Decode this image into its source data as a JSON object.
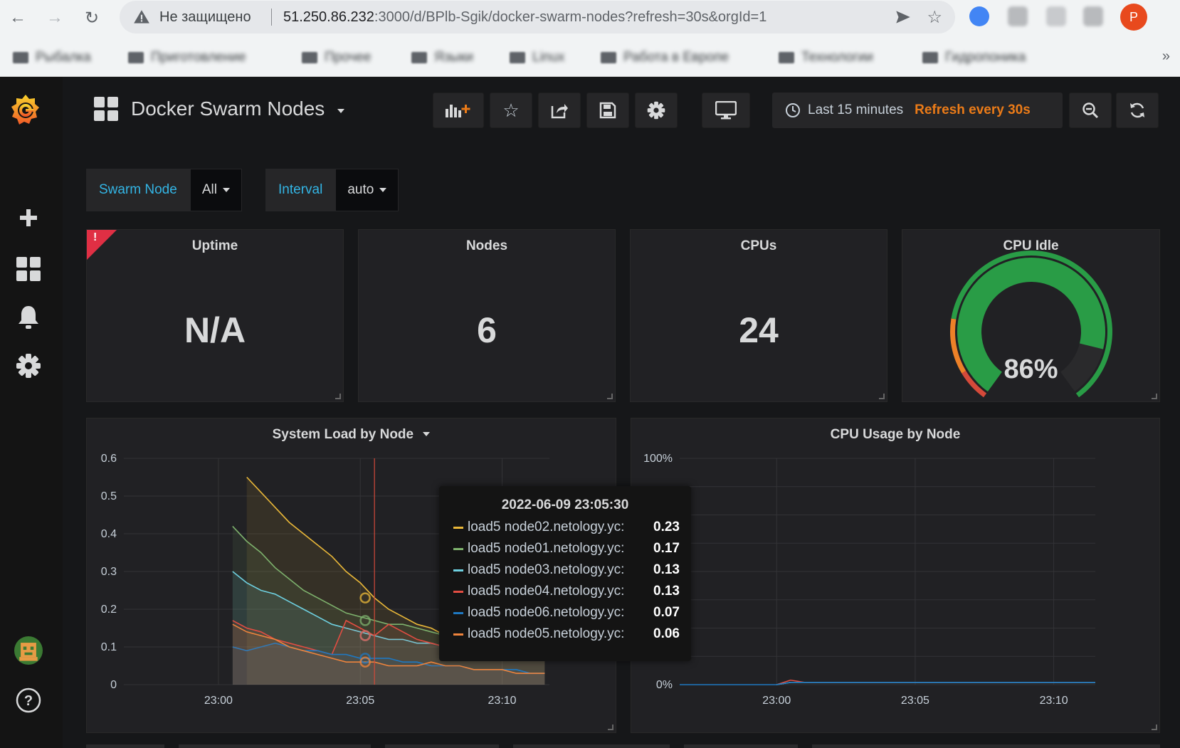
{
  "browser": {
    "insecure_label": "Не защищено",
    "url_host": "51.250.86.232",
    "url_rest": ":3000/d/BPlb-Sgik/docker-swarm-nodes?refresh=30s&orgId=1",
    "bookmarks": [
      "Рыбалка",
      "Приготовление",
      "Прочее",
      "Языки",
      "Linux",
      "Работа в Европе",
      "Технологии",
      "Гидропоника"
    ],
    "profile_initial": "P"
  },
  "dashboard": {
    "title": "Docker Swarm Nodes",
    "time_range": "Last 15 minutes",
    "refresh": "Refresh every 30s"
  },
  "variables": [
    {
      "label": "Swarm Node",
      "value": "All"
    },
    {
      "label": "Interval",
      "value": "auto"
    }
  ],
  "stats": {
    "uptime": {
      "title": "Uptime",
      "value": "N/A",
      "error_mark": "!"
    },
    "nodes": {
      "title": "Nodes",
      "value": "6"
    },
    "cpus": {
      "title": "CPUs",
      "value": "24"
    },
    "cpu_idle": {
      "title": "CPU Idle",
      "value": "86%",
      "percent": 86
    }
  },
  "colors": {
    "accent_orange": "#eb7b18",
    "gauge_green": "#299c46",
    "gauge_orange": "#ed8128",
    "gauge_red": "#d44a3a",
    "variable_blue": "#33b5e5"
  },
  "chart_data": [
    {
      "type": "area",
      "title": "System Load by Node",
      "x_ticks": [
        "23:00",
        "23:05",
        "23:10"
      ],
      "y_ticks": [
        "0",
        "0.1",
        "0.2",
        "0.3",
        "0.4",
        "0.5",
        "0.6"
      ],
      "ylim": [
        0,
        0.6
      ],
      "x": [
        "23:00:30",
        "23:01",
        "23:01:30",
        "23:02",
        "23:02:30",
        "23:03",
        "23:03:30",
        "23:04",
        "23:04:30",
        "23:05",
        "23:05:30",
        "23:06",
        "23:06:30",
        "23:07",
        "23:07:30",
        "23:08",
        "23:08:30",
        "23:09",
        "23:09:30",
        "23:10",
        "23:10:30",
        "23:11",
        "23:11:30"
      ],
      "series": [
        {
          "name": "load5 node02.netology.yc",
          "color": "#eab839",
          "values": [
            null,
            0.55,
            0.51,
            0.47,
            0.43,
            0.4,
            0.37,
            0.34,
            0.3,
            0.27,
            0.23,
            0.2,
            0.18,
            0.16,
            0.15,
            0.13,
            0.12,
            0.11,
            0.11,
            0.1,
            0.1,
            0.09,
            0.09
          ]
        },
        {
          "name": "load5 node01.netology.yc",
          "color": "#7eb26d",
          "values": [
            0.42,
            0.38,
            0.35,
            0.31,
            0.28,
            0.25,
            0.23,
            0.21,
            0.19,
            0.18,
            0.17,
            0.16,
            0.16,
            0.15,
            0.14,
            0.13,
            0.12,
            0.11,
            0.11,
            0.1,
            0.1,
            0.09,
            0.09
          ]
        },
        {
          "name": "load5 node03.netology.yc",
          "color": "#6ed0e0",
          "values": [
            0.3,
            0.27,
            0.25,
            0.24,
            0.22,
            0.2,
            0.18,
            0.16,
            0.15,
            0.14,
            0.13,
            0.12,
            0.12,
            0.11,
            0.11,
            0.1,
            0.1,
            0.09,
            0.09,
            0.09,
            0.08,
            0.08,
            0.08
          ]
        },
        {
          "name": "load5 node04.netology.yc",
          "color": "#e24d42",
          "values": [
            0.17,
            0.15,
            0.14,
            0.12,
            0.11,
            0.1,
            0.09,
            0.08,
            0.17,
            0.15,
            0.13,
            0.16,
            0.14,
            0.12,
            0.11,
            0.1,
            0.1,
            0.09,
            0.09,
            0.08,
            0.08,
            0.07,
            0.07
          ]
        },
        {
          "name": "load5 node06.netology.yc",
          "color": "#1f78c1",
          "values": [
            0.1,
            0.09,
            0.1,
            0.11,
            0.1,
            0.09,
            0.09,
            0.08,
            0.08,
            0.07,
            0.07,
            0.07,
            0.06,
            0.06,
            0.05,
            0.05,
            0.05,
            0.04,
            0.04,
            0.04,
            0.04,
            0.03,
            0.03
          ]
        },
        {
          "name": "load5 node05.netology.yc",
          "color": "#ef843c",
          "values": [
            0.16,
            0.14,
            0.13,
            0.12,
            0.1,
            0.09,
            0.08,
            0.07,
            0.06,
            0.06,
            0.06,
            0.05,
            0.05,
            0.05,
            0.06,
            0.05,
            0.05,
            0.04,
            0.04,
            0.04,
            0.03,
            0.03,
            0.03
          ]
        }
      ]
    },
    {
      "type": "line",
      "title": "CPU Usage by Node",
      "x_ticks": [
        "23:00",
        "23:05",
        "23:10"
      ],
      "y_ticks": [
        "0%",
        "100%"
      ],
      "ylim": [
        0,
        100
      ],
      "x": [
        "22:56:30",
        "23:00",
        "23:00:30",
        "23:01",
        "23:05",
        "23:10",
        "23:11:30"
      ],
      "series": [
        {
          "color": "#7eb26d",
          "values": [
            null,
            0,
            1,
            1,
            1,
            1,
            1
          ]
        },
        {
          "color": "#e24d42",
          "values": [
            null,
            0,
            2,
            1,
            1,
            1,
            1
          ]
        },
        {
          "color": "#6ed0e0",
          "values": [
            null,
            0,
            1,
            1,
            1,
            1,
            1
          ]
        },
        {
          "color": "#1f78c1",
          "values": [
            0,
            0,
            1,
            1,
            1,
            1,
            1
          ]
        }
      ]
    }
  ],
  "tooltip": {
    "time": "2022-06-09 23:05:30",
    "rows": [
      {
        "name": "load5 node02.netology.yc:",
        "value": "0.23",
        "color": "#eab839"
      },
      {
        "name": "load5 node01.netology.yc:",
        "value": "0.17",
        "color": "#7eb26d"
      },
      {
        "name": "load5 node03.netology.yc:",
        "value": "0.13",
        "color": "#6ed0e0"
      },
      {
        "name": "load5 node04.netology.yc:",
        "value": "0.13",
        "color": "#e24d42"
      },
      {
        "name": "load5 node06.netology.yc:",
        "value": "0.07",
        "color": "#1f78c1"
      },
      {
        "name": "load5 node05.netology.yc:",
        "value": "0.06",
        "color": "#ef843c"
      }
    ]
  }
}
